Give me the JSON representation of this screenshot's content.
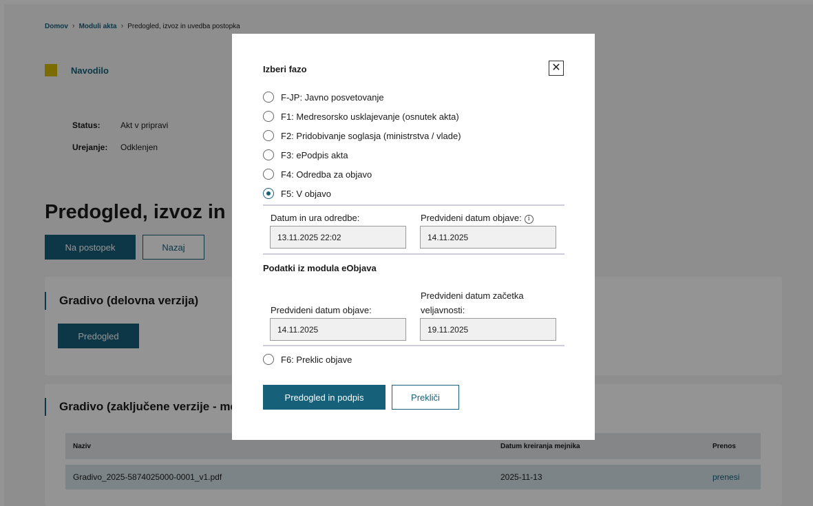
{
  "breadcrumb": {
    "home": "Domov",
    "modules": "Moduli akta",
    "current": "Predogled, izvoz in uvedba postopka",
    "separator": "›"
  },
  "instructions": {
    "label": "Navodilo",
    "marker_color": "#d5bb00"
  },
  "status": {
    "status_key": "Status:",
    "status_value": "Akt v pripravi",
    "edit_key": "Urejanje:",
    "edit_value": "Odklenjen"
  },
  "page": {
    "title": "Predogled, izvoz in uvedba postopka",
    "primary_button": "Na postopek",
    "back_button": "Nazaj"
  },
  "working_material": {
    "title": "Gradivo (delovna verzija)",
    "preview_button": "Predogled"
  },
  "final_material": {
    "title": "Gradivo (zaključene verzije - mejniki)",
    "columns": {
      "name": "Naziv",
      "date": "Datum kreiranja mejnika",
      "download": "Prenos"
    },
    "rows": [
      {
        "name": "Gradivo_2025-5874025000-0001_v1.pdf",
        "date": "2025-11-13",
        "download": "prenesi"
      }
    ]
  },
  "modal": {
    "title": "Izberi fazo",
    "close_icon": "close-icon",
    "phases": [
      {
        "label": "F-JP: Javno posvetovanje",
        "checked": false
      },
      {
        "label": "F1: Medresorsko usklajevanje (osnutek akta)",
        "checked": false
      },
      {
        "label": "F2: Pridobivanje soglasja (ministrstva / vlade)",
        "checked": false
      },
      {
        "label": "F3: ePodpis akta",
        "checked": false
      },
      {
        "label": "F4: Odredba za objavo",
        "checked": false
      },
      {
        "label": "F5: V objavo",
        "checked": true
      }
    ],
    "order_datetime_label": "Datum in ura odredbe:",
    "order_datetime_value": "13.11.2025 22:02",
    "planned_pub_label": "Predvideni datum objave:",
    "planned_pub_value": "14.11.2025",
    "info_icon": "info-icon",
    "eobjava_title": "Podatki iz modula eObjava",
    "eobjava_pub_label": "Predvideni datum objave:",
    "eobjava_pub_value": "14.11.2025",
    "eobjava_valid_label_line1": "Predvideni datum začetka",
    "eobjava_valid_label_line2": "veljavnosti:",
    "eobjava_valid_value": "19.11.2025",
    "f6_label": "F6: Preklic objave",
    "f6_checked": false,
    "submit_button": "Predogled in podpis",
    "cancel_button": "Prekliči"
  },
  "colors": {
    "accent": "#17607a",
    "overlay": "rgba(0,0,0,0.42)"
  }
}
